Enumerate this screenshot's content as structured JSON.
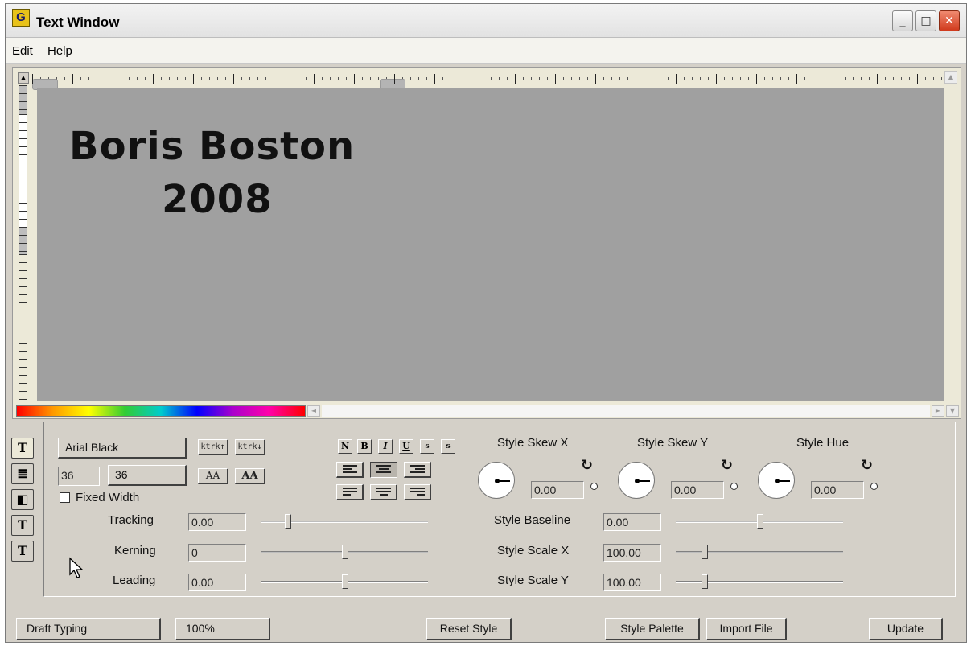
{
  "window": {
    "title": "Text Window",
    "icon_letter": "G"
  },
  "menu": [
    "Edit",
    "Help"
  ],
  "canvas": {
    "lines": [
      "Boris Boston",
      "2008"
    ]
  },
  "tabs": [
    "T",
    "≣",
    "◧",
    "T",
    "T"
  ],
  "font": {
    "name": "Arial Black",
    "size_1": "36",
    "size_2": "36",
    "fixed_width_label": "Fixed Width",
    "fixed_width_checked": false
  },
  "format_buttons": [
    "N",
    "B",
    "I",
    "U",
    "s",
    "s"
  ],
  "kerning_buttons": [
    "ktrk↑",
    "ktrk↓"
  ],
  "case_buttons": [
    "AA",
    "AA"
  ],
  "sliders_left": [
    {
      "label": "Tracking",
      "value": "0.00"
    },
    {
      "label": "Kerning",
      "value": "0"
    },
    {
      "label": "Leading",
      "value": "0.00"
    }
  ],
  "dials": [
    {
      "label": "Style Skew X",
      "value": "0.00"
    },
    {
      "label": "Style Skew Y",
      "value": "0.00"
    },
    {
      "label": "Style Hue",
      "value": "0.00"
    }
  ],
  "sliders_right": [
    {
      "label": "Style Baseline",
      "value": "0.00"
    },
    {
      "label": "Style Scale X",
      "value": "100.00"
    },
    {
      "label": "Style Scale Y",
      "value": "100.00"
    }
  ],
  "bottom": {
    "mode": "Draft Typing",
    "zoom": "100%",
    "reset_style": "Reset Style",
    "style_palette": "Style Palette",
    "import_file": "Import File",
    "update": "Update"
  }
}
